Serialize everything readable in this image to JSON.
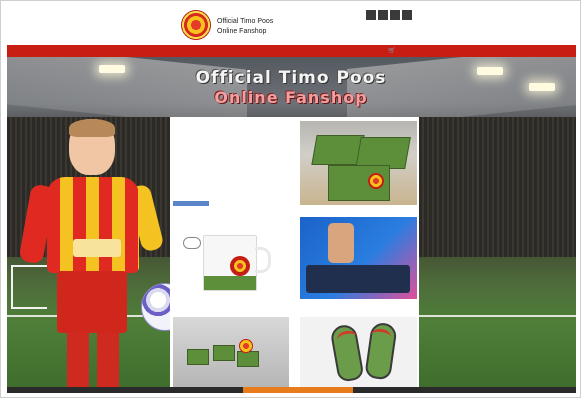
{
  "header": {
    "brand_line1": "Official Timo Poos",
    "brand_line2": "Online Fanshop",
    "login_text": "",
    "extra_text": "",
    "boxes": [
      "",
      "",
      "",
      ""
    ]
  },
  "nav": {
    "items": [
      "",
      "",
      "",
      ""
    ],
    "cart_icon": "cart-icon",
    "cart_count": "",
    "bar_color": "#c71d13"
  },
  "banner": {
    "title_line1": "Official Timo Poos",
    "title_line2": "Online Fanshop"
  },
  "hero": {
    "jersey_sponsor": "",
    "shorts_text": ""
  },
  "panel": {
    "intro_lines": [
      "",
      "",
      "",
      "",
      "",
      "",
      "",
      "",
      "",
      "",
      "",
      ""
    ],
    "more_button": ""
  },
  "products": [
    {
      "caption": ""
    },
    {
      "caption": ""
    },
    {
      "caption": ""
    },
    {
      "caption": ""
    },
    {
      "caption": ""
    }
  ],
  "footer": {
    "link_text": ""
  },
  "colors": {
    "accent_red": "#c71d13",
    "caption_pink": "#f4c9cf",
    "footer_orange": "#e87b1a"
  }
}
